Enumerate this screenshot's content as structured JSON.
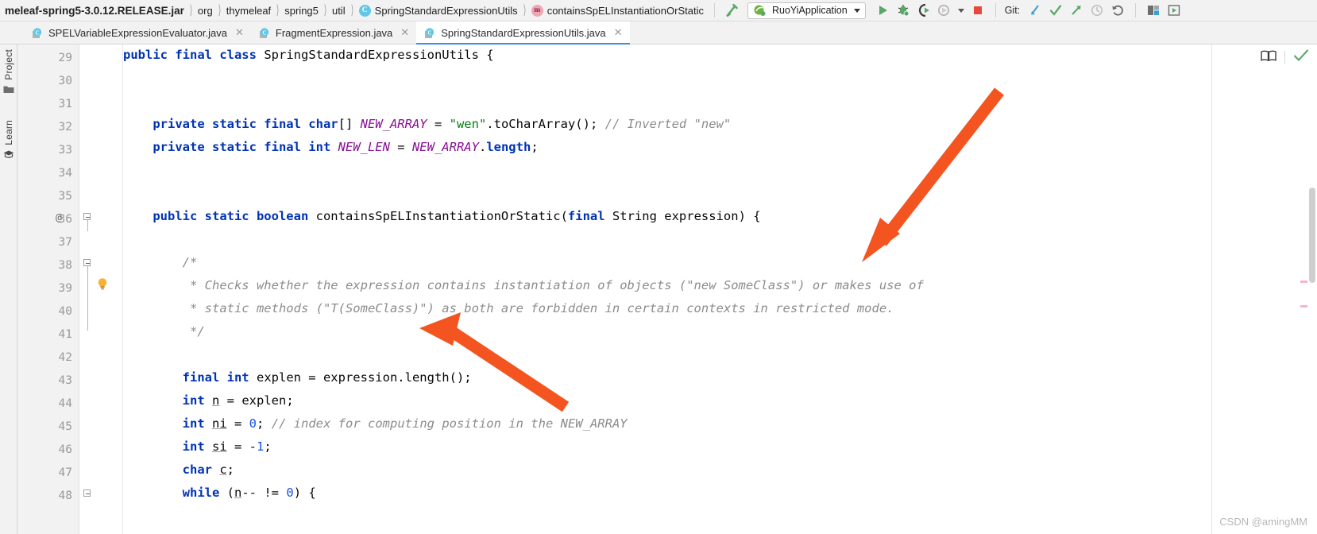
{
  "breadcrumb": {
    "jar": "meleaf-spring5-3.0.12.RELEASE.jar",
    "items": [
      "org",
      "thymeleaf",
      "spring5",
      "util"
    ],
    "class_name": "SpringStandardExpressionUtils",
    "class_icon": "C",
    "method_name": "containsSpELInstantiationOrStatic",
    "method_icon": "m"
  },
  "toolbar": {
    "run_config": "RuoYiApplication",
    "git_label": "Git:",
    "icons": [
      "build-hammer-icon",
      "run-icon",
      "debug-icon",
      "run-with-coverage-icon",
      "profiler-icon",
      "stop-icon",
      "git-update-icon",
      "git-commit-icon",
      "git-push-icon",
      "git-history-icon",
      "git-rollback-icon",
      "search-everywhere-icon",
      "open-settings-icon"
    ]
  },
  "tabs": [
    {
      "label": "SPELVariableExpressionEvaluator.java",
      "active": false
    },
    {
      "label": "FragmentExpression.java",
      "active": false
    },
    {
      "label": "SpringStandardExpressionUtils.java",
      "active": true
    }
  ],
  "toolwindows": [
    {
      "label": "Project",
      "icon": "folder-icon"
    },
    {
      "label": "Learn",
      "icon": "graduation-cap-icon"
    }
  ],
  "editor": {
    "inspection_widget_icons": [
      "reader-mode-icon",
      "inspections-ok-icon"
    ],
    "line_numbers": [
      "29",
      "30",
      "31",
      "32",
      "33",
      "34",
      "35",
      "36",
      "37",
      "38",
      "39",
      "40",
      "41",
      "42",
      "43",
      "44",
      "45",
      "46",
      "47",
      "48"
    ],
    "highlighted_line": "39",
    "lines": [
      {
        "num": "29",
        "text": "public final class SpringStandardExpressionUtils {"
      },
      {
        "num": "30",
        "text": ""
      },
      {
        "num": "31",
        "text": ""
      },
      {
        "num": "32",
        "text": "    private static final char[] NEW_ARRAY = \"wen\".toCharArray(); // Inverted \"new\""
      },
      {
        "num": "33",
        "text": "    private static final int NEW_LEN = NEW_ARRAY.length;"
      },
      {
        "num": "34",
        "text": ""
      },
      {
        "num": "35",
        "text": ""
      },
      {
        "num": "36",
        "text": "    public static boolean containsSpELInstantiationOrStatic(final String expression) {"
      },
      {
        "num": "37",
        "text": ""
      },
      {
        "num": "38",
        "text": "        /*"
      },
      {
        "num": "39",
        "text": "         * Checks whether the expression contains instantiation of objects (\"new SomeClass\") or makes use of"
      },
      {
        "num": "40",
        "text": "         * static methods (\"T(SomeClass)\") as both are forbidden in certain contexts in restricted mode."
      },
      {
        "num": "41",
        "text": "         */"
      },
      {
        "num": "42",
        "text": ""
      },
      {
        "num": "43",
        "text": "        final int explen = expression.length();"
      },
      {
        "num": "44",
        "text": "        int n = explen;"
      },
      {
        "num": "45",
        "text": "        int ni = 0; // index for computing position in the NEW_ARRAY"
      },
      {
        "num": "46",
        "text": "        int si = -1;"
      },
      {
        "num": "47",
        "text": "        char c;"
      },
      {
        "num": "48",
        "text": "        while (n-- != 0) {"
      }
    ],
    "gutter_at_line": "36",
    "bulb_line": "39"
  },
  "annotations": {
    "arrow_color": "#f4541f",
    "arrow_count": 2
  },
  "watermark": "CSDN @amingMM",
  "colors": {
    "keyword": "#0033b3",
    "field": "#871094",
    "string": "#067d17",
    "number": "#1750eb",
    "comment": "#8c8c8c",
    "tab_active_underline": "#3b8ee0",
    "highlight_row": "#fcf9e4",
    "arrow": "#f4541f"
  }
}
